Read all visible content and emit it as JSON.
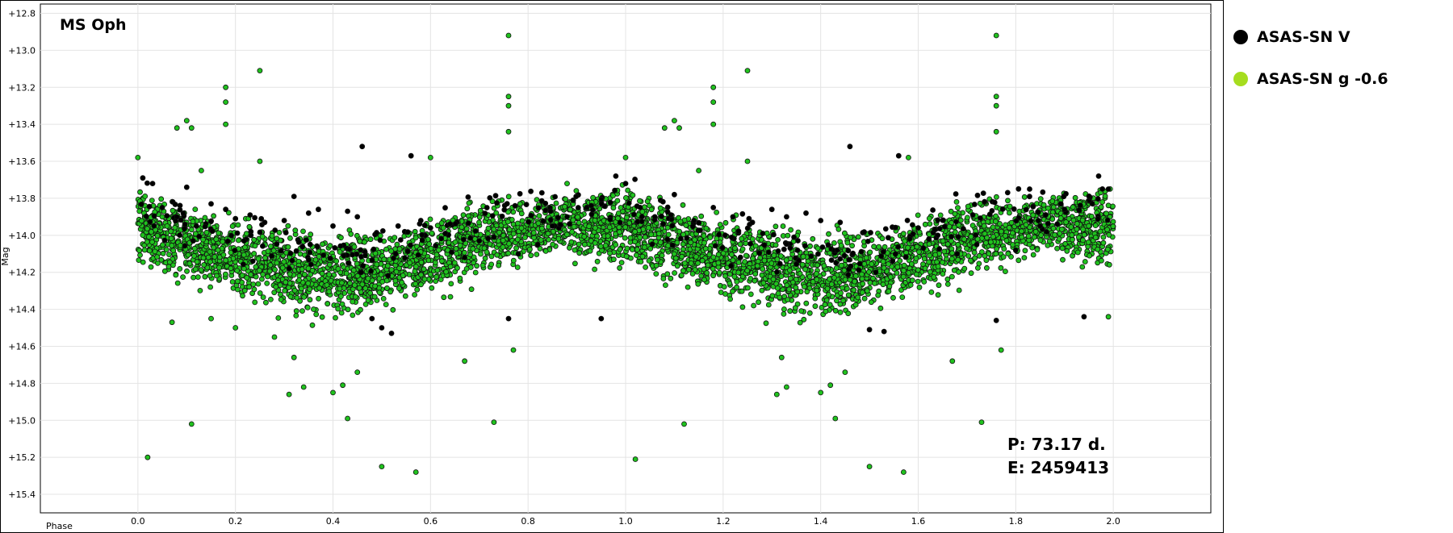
{
  "chart_data": {
    "type": "scatter",
    "title": "MS Oph",
    "xlabel": "Phase",
    "ylabel": "Mag",
    "xlim": [
      -0.2,
      2.2
    ],
    "ylim": [
      15.5,
      12.75
    ],
    "y_reversed": true,
    "x_ticks": [
      "0.0",
      "0.2",
      "0.4",
      "0.6",
      "0.8",
      "1.0",
      "1.2",
      "1.4",
      "1.6",
      "1.8",
      "2.0"
    ],
    "y_ticks": [
      "+12.8",
      "+13.0",
      "+13.2",
      "+13.4",
      "+13.6",
      "+13.8",
      "+14.0",
      "+14.2",
      "+14.4",
      "+14.6",
      "+14.8",
      "+15.0",
      "+15.2",
      "+15.4"
    ],
    "grid": true,
    "legend_position": "right",
    "annotations": [
      "P: 73.17 d.",
      "E: 2459413"
    ],
    "series": [
      {
        "name": "ASAS-SN V",
        "legend_color": "#000000",
        "color": "#000000",
        "points": [
          [
            0.01,
            13.69
          ],
          [
            0.03,
            13.72
          ],
          [
            0.05,
            13.85
          ],
          [
            0.08,
            13.9
          ],
          [
            0.1,
            13.74
          ],
          [
            0.12,
            13.95
          ],
          [
            0.15,
            13.83
          ],
          [
            0.18,
            13.86
          ],
          [
            0.2,
            13.91
          ],
          [
            0.23,
            13.89
          ],
          [
            0.26,
            13.93
          ],
          [
            0.3,
            13.92
          ],
          [
            0.32,
            13.79
          ],
          [
            0.35,
            13.88
          ],
          [
            0.37,
            13.86
          ],
          [
            0.4,
            13.95
          ],
          [
            0.43,
            13.87
          ],
          [
            0.45,
            13.9
          ],
          [
            0.46,
            13.52
          ],
          [
            0.48,
            14.45
          ],
          [
            0.5,
            14.5
          ],
          [
            0.52,
            14.53
          ],
          [
            0.56,
            13.57
          ],
          [
            0.58,
            13.92
          ],
          [
            0.6,
            13.96
          ],
          [
            0.63,
            13.99
          ],
          [
            0.67,
            14.12
          ],
          [
            0.7,
            14.03
          ],
          [
            0.73,
            14.01
          ],
          [
            0.76,
            14.45
          ],
          [
            0.78,
            14.1
          ],
          [
            0.82,
            14.05
          ],
          [
            0.85,
            13.95
          ],
          [
            0.88,
            13.9
          ],
          [
            0.92,
            13.85
          ],
          [
            0.95,
            14.45
          ],
          [
            0.98,
            13.68
          ],
          [
            1.0,
            13.72
          ],
          [
            1.03,
            13.85
          ],
          [
            1.06,
            13.9
          ],
          [
            1.1,
            13.78
          ],
          [
            1.14,
            13.92
          ],
          [
            1.18,
            13.85
          ],
          [
            1.22,
            13.9
          ],
          [
            1.26,
            13.93
          ],
          [
            1.3,
            13.86
          ],
          [
            1.33,
            13.9
          ],
          [
            1.37,
            13.88
          ],
          [
            1.4,
            13.92
          ],
          [
            1.44,
            13.93
          ],
          [
            1.46,
            13.52
          ],
          [
            1.5,
            14.51
          ],
          [
            1.53,
            14.52
          ],
          [
            1.56,
            13.57
          ],
          [
            1.6,
            13.96
          ],
          [
            1.64,
            14.0
          ],
          [
            1.68,
            14.1
          ],
          [
            1.72,
            14.05
          ],
          [
            1.76,
            14.46
          ],
          [
            1.8,
            14.08
          ],
          [
            1.85,
            13.95
          ],
          [
            1.9,
            13.86
          ],
          [
            1.94,
            14.44
          ],
          [
            1.97,
            13.68
          ],
          [
            1.99,
            13.75
          ]
        ]
      },
      {
        "name": "ASAS-SN g -0.6",
        "legend_color": "#a6dd1f",
        "color": "#20c21e",
        "points": [
          [
            0.0,
            13.58
          ],
          [
            0.02,
            15.2
          ],
          [
            0.05,
            13.9
          ],
          [
            0.07,
            14.47
          ],
          [
            0.08,
            13.42
          ],
          [
            0.1,
            13.38
          ],
          [
            0.11,
            13.42
          ],
          [
            0.11,
            15.02
          ],
          [
            0.13,
            13.65
          ],
          [
            0.15,
            14.45
          ],
          [
            0.18,
            13.2
          ],
          [
            0.18,
            13.28
          ],
          [
            0.18,
            13.4
          ],
          [
            0.2,
            14.5
          ],
          [
            0.25,
            13.11
          ],
          [
            0.25,
            13.6
          ],
          [
            0.28,
            14.55
          ],
          [
            0.31,
            14.86
          ],
          [
            0.32,
            14.66
          ],
          [
            0.34,
            14.82
          ],
          [
            0.4,
            14.85
          ],
          [
            0.42,
            14.81
          ],
          [
            0.43,
            14.99
          ],
          [
            0.45,
            14.74
          ],
          [
            0.5,
            15.25
          ],
          [
            0.57,
            15.28
          ],
          [
            0.6,
            13.58
          ],
          [
            0.67,
            14.68
          ],
          [
            0.73,
            15.01
          ],
          [
            0.76,
            12.92
          ],
          [
            0.76,
            13.25
          ],
          [
            0.76,
            13.3
          ],
          [
            0.76,
            13.44
          ],
          [
            0.77,
            14.62
          ],
          [
            0.88,
            13.72
          ],
          [
            1.0,
            13.58
          ],
          [
            1.02,
            15.21
          ],
          [
            1.08,
            13.42
          ],
          [
            1.1,
            13.38
          ],
          [
            1.11,
            13.42
          ],
          [
            1.12,
            15.02
          ],
          [
            1.15,
            13.65
          ],
          [
            1.18,
            13.2
          ],
          [
            1.18,
            13.28
          ],
          [
            1.18,
            13.4
          ],
          [
            1.25,
            13.11
          ],
          [
            1.25,
            13.6
          ],
          [
            1.31,
            14.86
          ],
          [
            1.32,
            14.66
          ],
          [
            1.33,
            14.82
          ],
          [
            1.4,
            14.85
          ],
          [
            1.42,
            14.81
          ],
          [
            1.43,
            14.99
          ],
          [
            1.45,
            14.74
          ],
          [
            1.5,
            15.25
          ],
          [
            1.57,
            15.28
          ],
          [
            1.58,
            13.58
          ],
          [
            1.67,
            14.68
          ],
          [
            1.73,
            15.01
          ],
          [
            1.76,
            12.92
          ],
          [
            1.76,
            13.25
          ],
          [
            1.76,
            13.3
          ],
          [
            1.76,
            13.44
          ],
          [
            1.77,
            14.62
          ],
          [
            1.99,
            14.44
          ]
        ],
        "band_profile": {
          "phase": [
            0.0,
            0.1,
            0.2,
            0.3,
            0.4,
            0.5,
            0.6,
            0.7,
            0.8,
            0.9,
            1.0
          ],
          "center_mag": [
            13.95,
            14.05,
            14.12,
            14.18,
            14.22,
            14.2,
            14.12,
            14.02,
            13.97,
            13.95,
            13.95
          ],
          "spread_mag": [
            0.38,
            0.32,
            0.32,
            0.35,
            0.35,
            0.33,
            0.35,
            0.33,
            0.3,
            0.3,
            0.38
          ],
          "points_per_cycle": 2200
        }
      }
    ]
  }
}
